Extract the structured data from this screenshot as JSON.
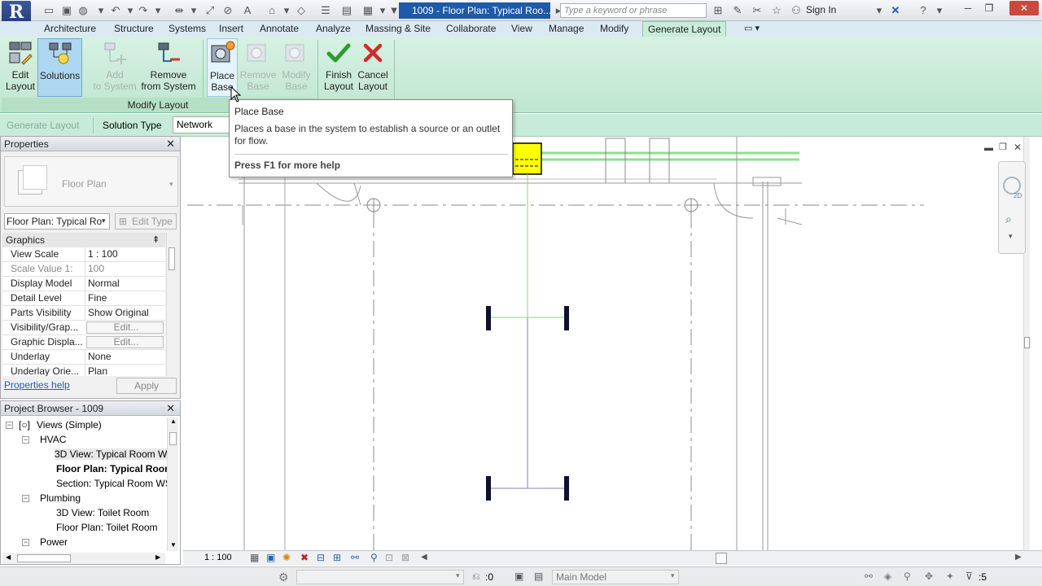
{
  "titlebar": {
    "doc_title": "1009 - Floor Plan: Typical Roo...",
    "search_placeholder": "Type a keyword or phrase",
    "sign_in": "Sign In"
  },
  "ribbon_tabs": [
    "Architecture",
    "Structure",
    "Systems",
    "Insert",
    "Annotate",
    "Analyze",
    "Massing & Site",
    "Collaborate",
    "View",
    "Manage",
    "Modify",
    "Generate Layout"
  ],
  "active_tab": "Generate Layout",
  "ribbon": {
    "edit_layout": [
      "Edit",
      "Layout"
    ],
    "solutions": [
      "Solutions"
    ],
    "add_to_system": [
      "Add",
      "to System"
    ],
    "remove_from_system": [
      "Remove",
      "from System"
    ],
    "place_base": [
      "Place",
      "Base"
    ],
    "remove_base": [
      "Remove",
      "Base"
    ],
    "modify_base": [
      "Modify",
      "Base"
    ],
    "finish_layout": [
      "Finish",
      "Layout"
    ],
    "cancel_layout": [
      "Cancel",
      "Layout"
    ],
    "panel_title": "Modify Layout"
  },
  "options_bar": {
    "generate_layout": "Generate Layout",
    "solution_type_label": "Solution Type",
    "solution_type_value": "Network"
  },
  "tooltip": {
    "title": "Place Base",
    "description": "Places a base in the system to establish a source or an outlet for flow.",
    "footer": "Press F1 for more help"
  },
  "properties": {
    "title": "Properties",
    "type_name": "Floor Plan",
    "view_selector": "Floor Plan: Typical Ro",
    "edit_type": "Edit Type",
    "section": "Graphics",
    "rows": [
      {
        "key": "View Scale",
        "value": "1 : 100",
        "dim": false
      },
      {
        "key": "Scale Value    1:",
        "value": "100",
        "dim": true
      },
      {
        "key": "Display Model",
        "value": "Normal",
        "dim": false
      },
      {
        "key": "Detail Level",
        "value": "Fine",
        "dim": false
      },
      {
        "key": "Parts Visibility",
        "value": "Show Original",
        "dim": false
      },
      {
        "key": "Visibility/Grap...",
        "value": "Edit...",
        "button": true
      },
      {
        "key": "Graphic Displa...",
        "value": "Edit...",
        "button": true
      },
      {
        "key": "Underlay",
        "value": "None",
        "dim": false
      },
      {
        "key": "Underlay Orie...",
        "value": "Plan",
        "dim": false
      }
    ],
    "help_link": "Properties help",
    "apply": "Apply"
  },
  "project_browser": {
    "title": "Project Browser - 1009",
    "root": "Views (Simple)",
    "nodes": [
      {
        "label": "HVAC",
        "level": 1,
        "expander": "−"
      },
      {
        "label": "3D View: Typical Room W",
        "level": 2,
        "selected": true
      },
      {
        "label": "Floor Plan: Typical Room",
        "level": 2,
        "bold": true
      },
      {
        "label": "Section: Typical Room WS",
        "level": 2
      },
      {
        "label": "Plumbing",
        "level": 1,
        "expander": "−"
      },
      {
        "label": "3D View: Toilet Room",
        "level": 2
      },
      {
        "label": "Floor Plan: Toilet Room",
        "level": 2
      },
      {
        "label": "Power",
        "level": 1,
        "expander": "−"
      }
    ]
  },
  "view_bar": {
    "scale": "1 : 100"
  },
  "status_bar": {
    "selection_count": ":0",
    "workset": "Main Model",
    "filter_count": ":5"
  },
  "colors": {
    "ribbon_bg": "#c8ecd8",
    "title_highlight": "#1e5aa8",
    "base_fill": "#ffff00",
    "duct_green": "#7ed07e",
    "duct_purple": "#8a78b8"
  }
}
